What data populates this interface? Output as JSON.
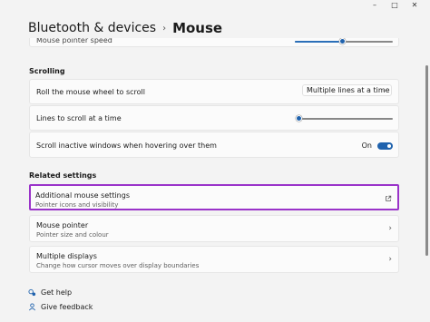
{
  "window": {
    "controls": {
      "minimize": "–",
      "maximize": "□",
      "close": "✕"
    }
  },
  "header": {
    "breadcrumb_parent": "Bluetooth & devices",
    "separator": "›",
    "current": "Mouse"
  },
  "top_partial": {
    "label": "Mouse pointer speed"
  },
  "scrolling": {
    "section_title": "Scrolling",
    "roll_wheel": {
      "label": "Roll the mouse wheel to scroll",
      "dropdown_value": "Multiple lines at a time",
      "dropdown_chevron": "⌄"
    },
    "lines_to_scroll": {
      "label": "Lines to scroll at a time",
      "slider_level": 0.0
    },
    "inactive_windows": {
      "label": "Scroll inactive windows when hovering over them",
      "toggle_label": "On",
      "toggle_state": true
    }
  },
  "related": {
    "section_title": "Related settings",
    "items": [
      {
        "title": "Additional mouse settings",
        "subtitle": "Pointer icons and visibility",
        "icon": "external-link-icon"
      },
      {
        "title": "Mouse pointer",
        "subtitle": "Pointer size and colour",
        "icon": "chevron-right-icon"
      },
      {
        "title": "Multiple displays",
        "subtitle": "Change how cursor moves over display boundaries",
        "icon": "chevron-right-icon"
      }
    ],
    "chevron": "›"
  },
  "footer": {
    "get_help": "Get help",
    "give_feedback": "Give feedback"
  },
  "colors": {
    "accent": "#1f62ad",
    "highlight": "#9a33c9",
    "background": "#f3f3f3",
    "card": "#fbfbfb"
  }
}
